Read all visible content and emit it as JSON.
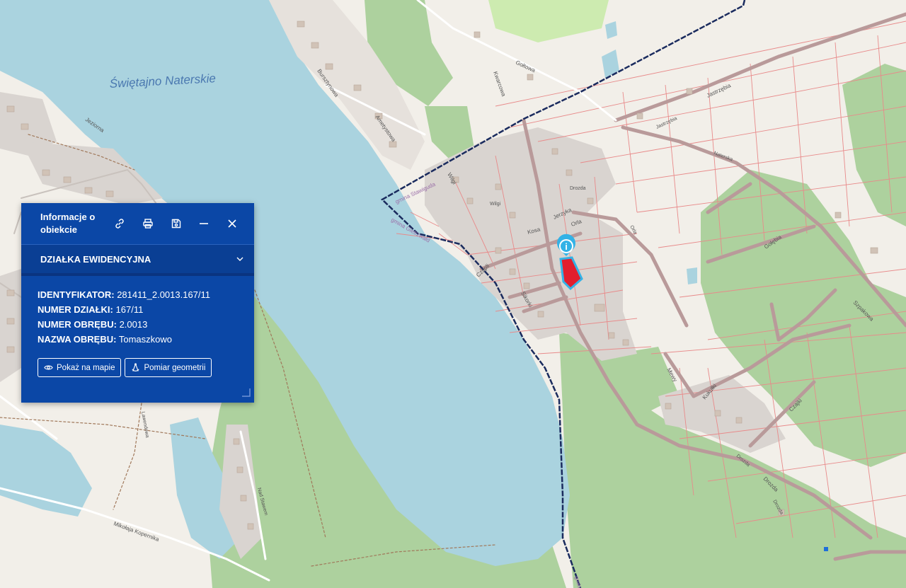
{
  "map": {
    "labels": {
      "lake": "Świętajno Naterskie",
      "bursztynowa": "Bursztynowa",
      "ametystowa": "Ametystowa",
      "jeziorna": "Jeziorna",
      "goltowa": "Gołtowa",
      "kwarcowa": "Kwarcowa",
      "jastrzebia": "Jastrzębia",
      "jastrzebia2": "Jastrzębia",
      "naterska": "Naterska",
      "gmina_stawiguda": "gmina Stawiguda",
      "gmina_gietrzwald": "gmina Gietrzwałd",
      "wilgi": "Wilgi",
      "wilgi2": "Wilgi",
      "drozda": "Drozda",
      "drozda2": "Drozda",
      "drozda3": "Drozda",
      "drozda4": "Drozda",
      "jerzyka": "Jerzyka",
      "kosa": "Kosa",
      "orla": "Orla",
      "orla2": "Orla",
      "czapli": "Czapli",
      "sikorki": "Sikorki",
      "golebia": "Gołębia",
      "szpakowa": "Szpakowa",
      "mewy": "Mewy",
      "kukulki": "Kukułki",
      "czajki": "Czajki",
      "lawendowa": "Lawendowa",
      "nad_stawem": "Nad Stawem",
      "kopernika": "Mikołaja Kopernika",
      "gmina_bottom": "gmin"
    },
    "colors": {
      "water": "#aad3df",
      "land": "#f2efe9",
      "forest": "#add19e",
      "parcel": "#e88a8a",
      "boundary": "#1a2b5e",
      "highlight": "#e21e2e"
    }
  },
  "panel": {
    "title": "Informacje o obiekcie",
    "section_title": "DZIAŁKA EWIDENCYJNA",
    "fields": [
      {
        "label": "IDENTYFIKATOR:",
        "value": "281411_2.0013.167/11"
      },
      {
        "label": "NUMER DZIAŁKI:",
        "value": "167/11"
      },
      {
        "label": "NUMER OBRĘBU:",
        "value": "2.0013"
      },
      {
        "label": "NAZWA OBRĘBU:",
        "value": "Tomaszkowo"
      }
    ],
    "buttons": {
      "show_on_map": "Pokaż na mapie",
      "measure": "Pomiar geometrii"
    },
    "icons": [
      "link-icon",
      "print-icon",
      "save-icon",
      "minimize-icon",
      "close-icon",
      "chevron-down-icon",
      "eye-icon",
      "measure-icon"
    ]
  },
  "marker": {
    "icon": "info-icon",
    "label": "i"
  }
}
